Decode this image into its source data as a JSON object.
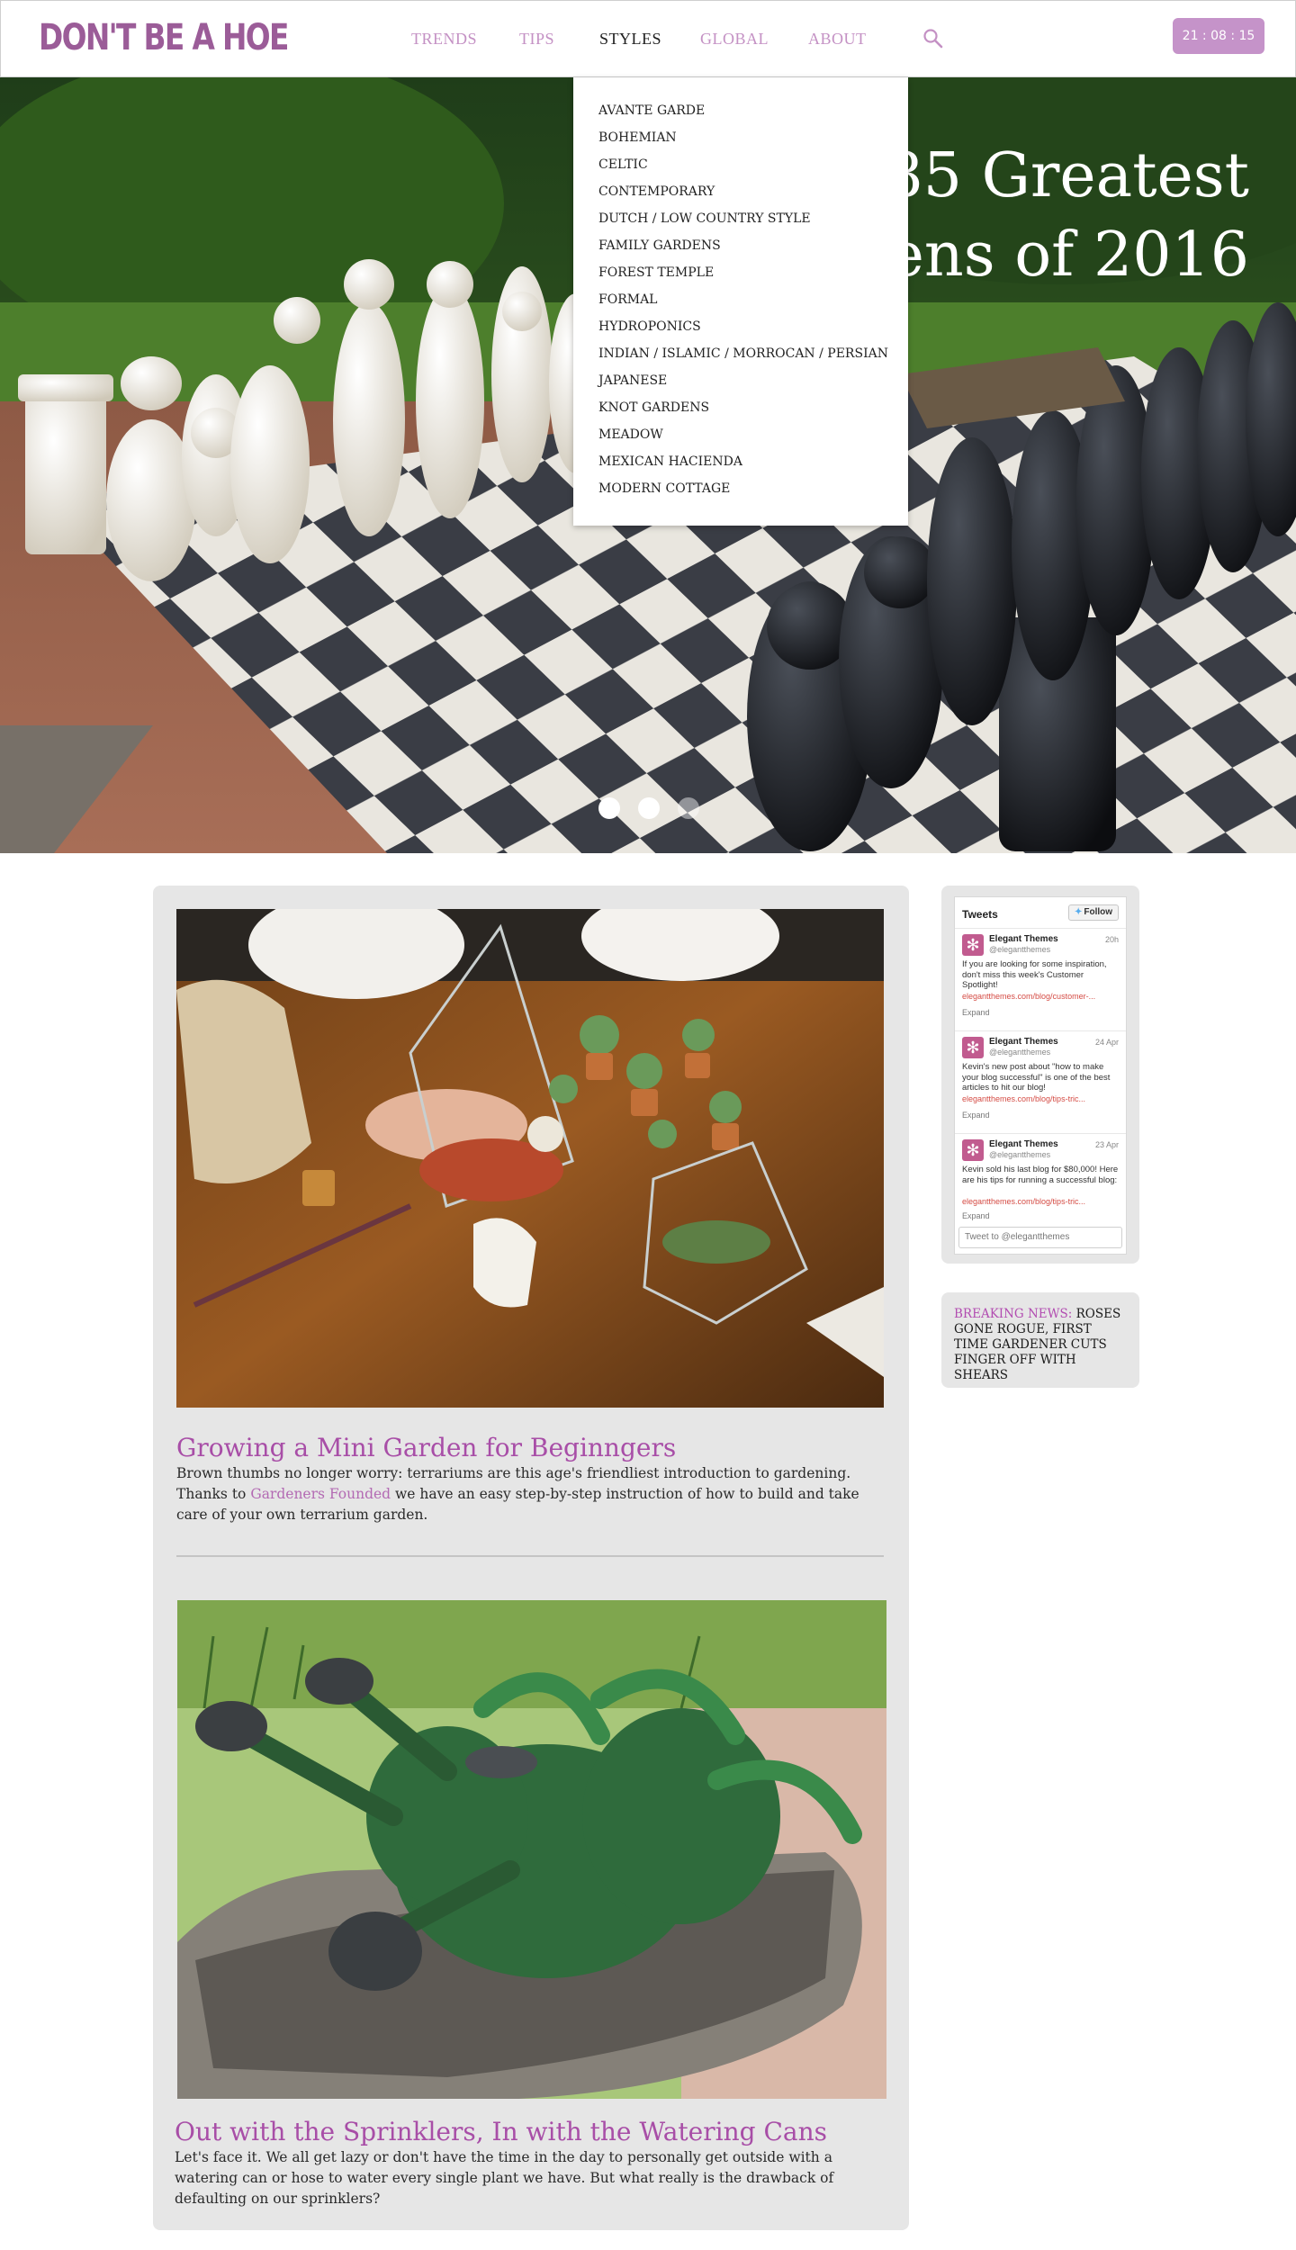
{
  "header": {
    "logo": "DON'T BE A HOE",
    "nav": [
      {
        "label": "TRENDS",
        "active": false
      },
      {
        "label": "TIPS",
        "active": false
      },
      {
        "label": "STYLES",
        "active": true
      },
      {
        "label": "GLOBAL",
        "active": false
      },
      {
        "label": "ABOUT",
        "active": false
      }
    ],
    "search_icon": "search-icon",
    "clock": "21 : 08 : 15"
  },
  "hero": {
    "title": "85 Greatest\ndens of 2016",
    "slide_count": 3,
    "active_slide": 1
  },
  "styles_menu": {
    "items": [
      "AVANTE GARDE",
      "BOHEMIAN",
      "CELTIC",
      "CONTEMPORARY",
      "DUTCH / LOW COUNTRY STYLE",
      "FAMILY GARDENS",
      "FOREST TEMPLE",
      "FORMAL",
      "HYDROPONICS",
      "INDIAN / ISLAMIC / MORROCAN / PERSIAN",
      "JAPANESE",
      "KNOT GARDENS",
      "MEADOW",
      "MEXICAN HACIENDA",
      "MODERN COTTAGE"
    ]
  },
  "posts": [
    {
      "title": "Growing a Mini Garden for Beginngers",
      "body_before": "Brown thumbs no longer worry: terrariums are this age's friendliest introduction to gardening. Thanks to ",
      "link": "Gardeners Founded",
      "body_after": " we have an easy step-by-step instruction of how to build and take care of your own terrarium garden."
    },
    {
      "title": "Out with the Sprinklers, In with the Watering Cans",
      "body": "Let's face it. We all get lazy or don't have the time in the day to personally get outside with a watering can or hose to water every single plant we have. But what really is the drawback of defaulting on our sprinklers?"
    }
  ],
  "twitter": {
    "heading": "Tweets",
    "follow": "Follow",
    "tweets": [
      {
        "name": "Elegant Themes",
        "handle": "@elegantthemes",
        "time": "20h",
        "text": "If you are looking for some inspiration, don't miss this week's Customer Spotlight!",
        "link": "elegantthemes.com/blog/customer-...",
        "expand": "Expand"
      },
      {
        "name": "Elegant Themes",
        "handle": "@elegantthemes",
        "time": "24 Apr",
        "text": "Kevin's new post about \"how to make your blog successful\" is one of the best articles to hit our blog!",
        "link": "elegantthemes.com/blog/tips-tric...",
        "expand": "Expand"
      },
      {
        "name": "Elegant Themes",
        "handle": "@elegantthemes",
        "time": "23 Apr",
        "text": "Kevin sold his last blog for $80,000! Here are his tips for running a successful blog:",
        "link": "elegantthemes.com/blog/tips-tric...",
        "expand": "Expand"
      }
    ],
    "input_placeholder": "Tweet to @elegantthemes"
  },
  "news": {
    "tag": "BREAKING NEWS:",
    "text": " ROSES GONE ROGUE, FIRST TIME GARDENER CUTS FINGER OFF WITH SHEARS"
  },
  "colors": {
    "brand": "#9b5c98",
    "accent": "#a84ea7",
    "nav_inactive": "#c491c4",
    "clock_bg": "#c593c9",
    "panel_bg": "#e6e6e6"
  }
}
